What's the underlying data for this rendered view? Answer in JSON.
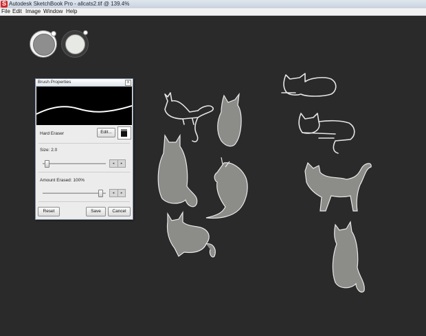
{
  "window": {
    "title": "Autodesk SketchBook Pro - allcats2.tif @ 139.4%",
    "logo_letter": "S"
  },
  "menu": {
    "items": [
      "File",
      "Edit",
      "Image",
      "Window",
      "Help"
    ]
  },
  "brush_properties": {
    "title": "Brush Properties",
    "close_glyph": "x",
    "brush_name": "Hard Eraser",
    "edit_button": "Edit...",
    "size_label": "Size: 2.0",
    "size_value": 0.05,
    "amount_label": "Amount Erased: 100%",
    "amount_value": 1.0,
    "stepper_left": "◂",
    "stepper_right": "▸",
    "reset_button": "Reset",
    "save_button": "Save",
    "cancel_button": "Cancel"
  },
  "colors": {
    "canvas": "#2a2a2a",
    "logo": "#d4282b",
    "stroke": "#e6e6e6"
  }
}
